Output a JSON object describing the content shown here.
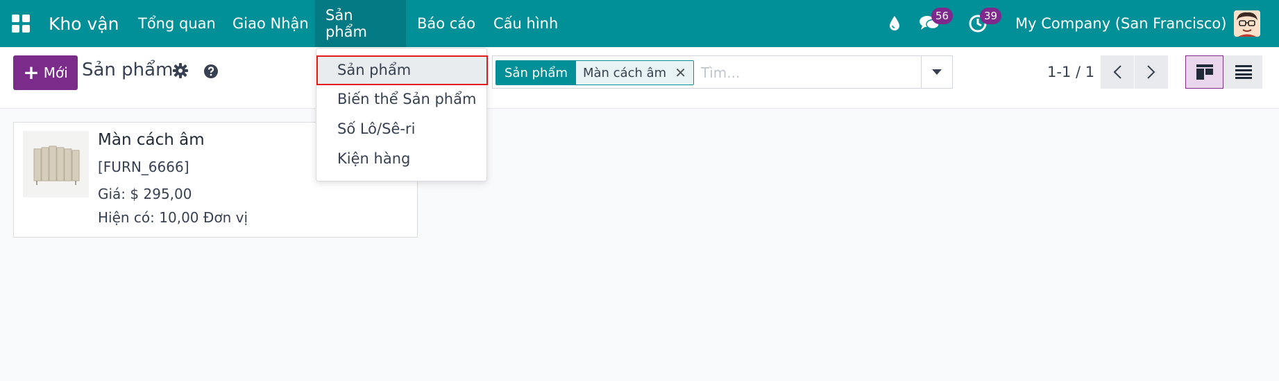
{
  "navbar": {
    "app_name": "Kho vận",
    "menu": [
      "Tổng quan",
      "Giao Nhận",
      "Sản phẩm",
      "Báo cáo",
      "Cấu hình"
    ],
    "open_menu_index": 2,
    "messages_count": "56",
    "activities_count": "39",
    "company": "My Company (San Francisco)"
  },
  "control": {
    "new_label": "Mới",
    "title": "Sản phẩm",
    "search": {
      "facet_label": "Sản phẩm",
      "facet_value": "Màn cách âm",
      "placeholder": "Tìm..."
    },
    "pager": "1-1 / 1"
  },
  "dropdown": {
    "items": [
      "Sản phẩm",
      "Biến thể Sản phẩm",
      "Số Lô/Sê-ri",
      "Kiện hàng"
    ],
    "selected_index": 0
  },
  "card": {
    "name": "Màn cách âm",
    "ref": "[FURN_6666]",
    "price": "Giá: $ 295,00",
    "on_hand": "Hiện có: 10,00 Đơn vị"
  },
  "colors": {
    "navbar": "#018f98",
    "primary": "#7b2c8b",
    "highlight_border": "#e21b1b"
  }
}
